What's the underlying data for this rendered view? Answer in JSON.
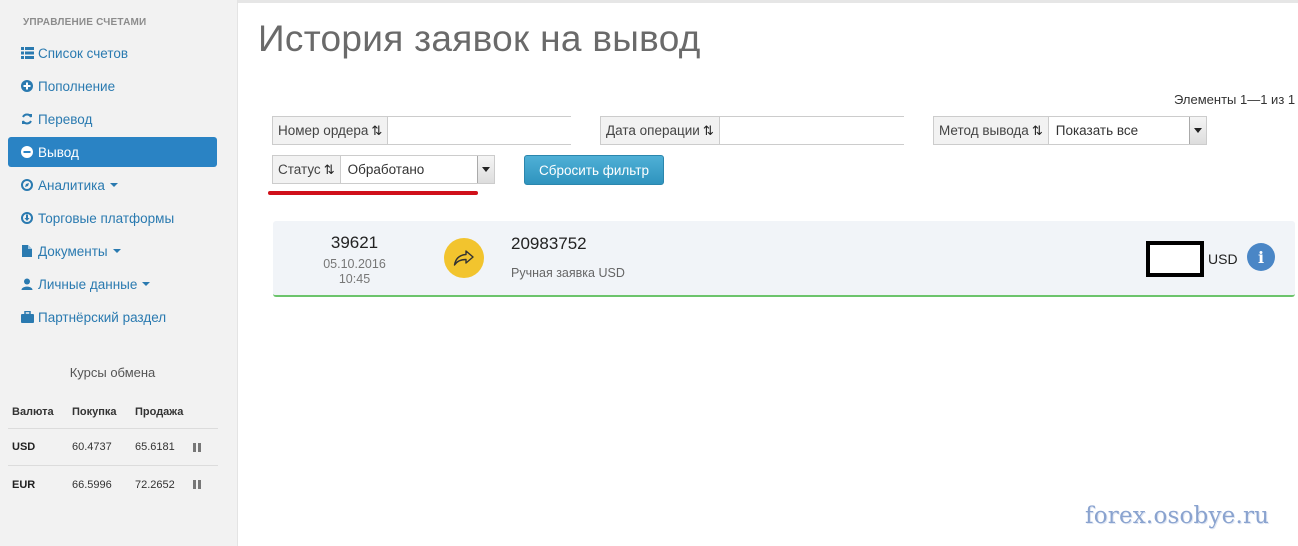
{
  "sidebar": {
    "section_title": "УПРАВЛЕНИЕ СЧЕТАМИ",
    "items": [
      {
        "label": "Список счетов",
        "icon": "list-icon"
      },
      {
        "label": "Пополнение",
        "icon": "plus-circle-icon"
      },
      {
        "label": "Перевод",
        "icon": "refresh-icon"
      },
      {
        "label": "Вывод",
        "icon": "minus-circle-icon",
        "active": true
      },
      {
        "label": "Аналитика",
        "icon": "compass-icon",
        "dropdown": true
      },
      {
        "label": "Торговые платформы",
        "icon": "download-circle-icon"
      },
      {
        "label": "Документы",
        "icon": "file-icon",
        "dropdown": true
      },
      {
        "label": "Личные данные",
        "icon": "user-icon",
        "dropdown": true
      },
      {
        "label": "Партнёрский раздел",
        "icon": "briefcase-icon"
      }
    ]
  },
  "rates": {
    "title": "Курсы обмена",
    "headers": [
      "Валюта",
      "Покупка",
      "Продажа"
    ],
    "rows": [
      {
        "currency": "USD",
        "buy": "60.4737",
        "sell": "65.6181"
      },
      {
        "currency": "EUR",
        "buy": "66.5996",
        "sell": "72.2652"
      }
    ]
  },
  "main": {
    "title": "История заявок на вывод",
    "elements_count": "Элементы 1—1 из 1",
    "filters": {
      "order_number": {
        "label": "Номер ордера",
        "value": ""
      },
      "operation_date": {
        "label": "Дата операции",
        "value": ""
      },
      "withdraw_method": {
        "label": "Метод вывода",
        "value": "Показать все"
      },
      "status": {
        "label": "Статус",
        "value": "Обработано"
      }
    },
    "reset_button": "Сбросить фильтр"
  },
  "order": {
    "number": "39621",
    "date": "05.10.2016",
    "time": "10:45",
    "id": "20983752",
    "description": "Ручная заявка USD",
    "currency": "USD",
    "info_icon": "i",
    "status_color": "#6cc46c",
    "icon_color": "#f2c42e"
  },
  "watermark": "forex.osobye.ru"
}
